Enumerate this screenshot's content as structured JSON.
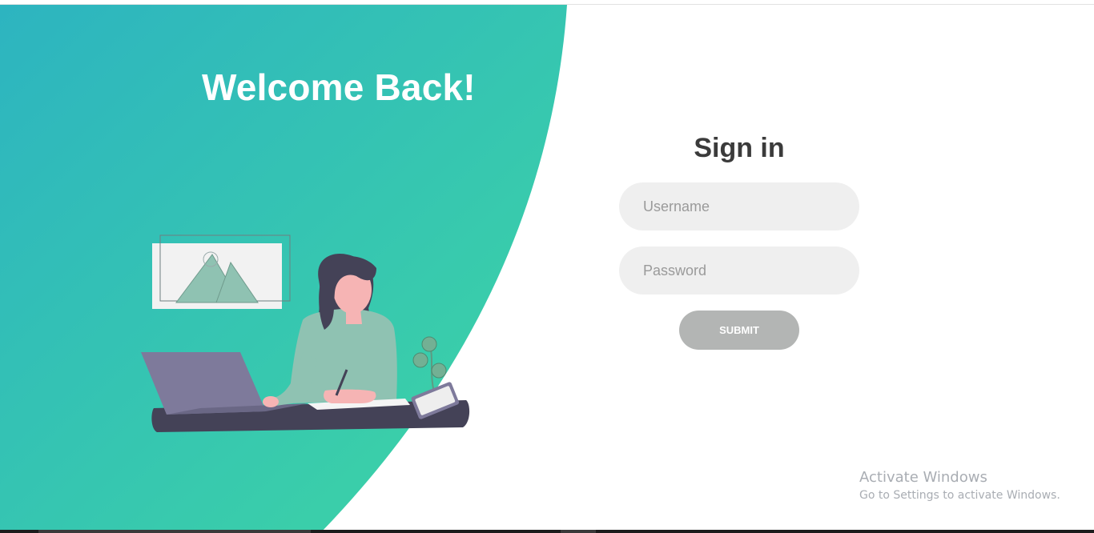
{
  "left_panel": {
    "heading": "Welcome Back!",
    "gradient_colors": [
      "#2db4c0",
      "#3ed6a3"
    ],
    "illustration": "person-working-at-laptop-illustration"
  },
  "signin": {
    "title": "Sign in",
    "username_placeholder": "Username",
    "password_placeholder": "Password",
    "submit_label": "SUBMIT",
    "submit_color": "#b3b5b4"
  },
  "watermark": {
    "title": "Activate Windows",
    "subtitle": "Go to Settings to activate Windows."
  }
}
